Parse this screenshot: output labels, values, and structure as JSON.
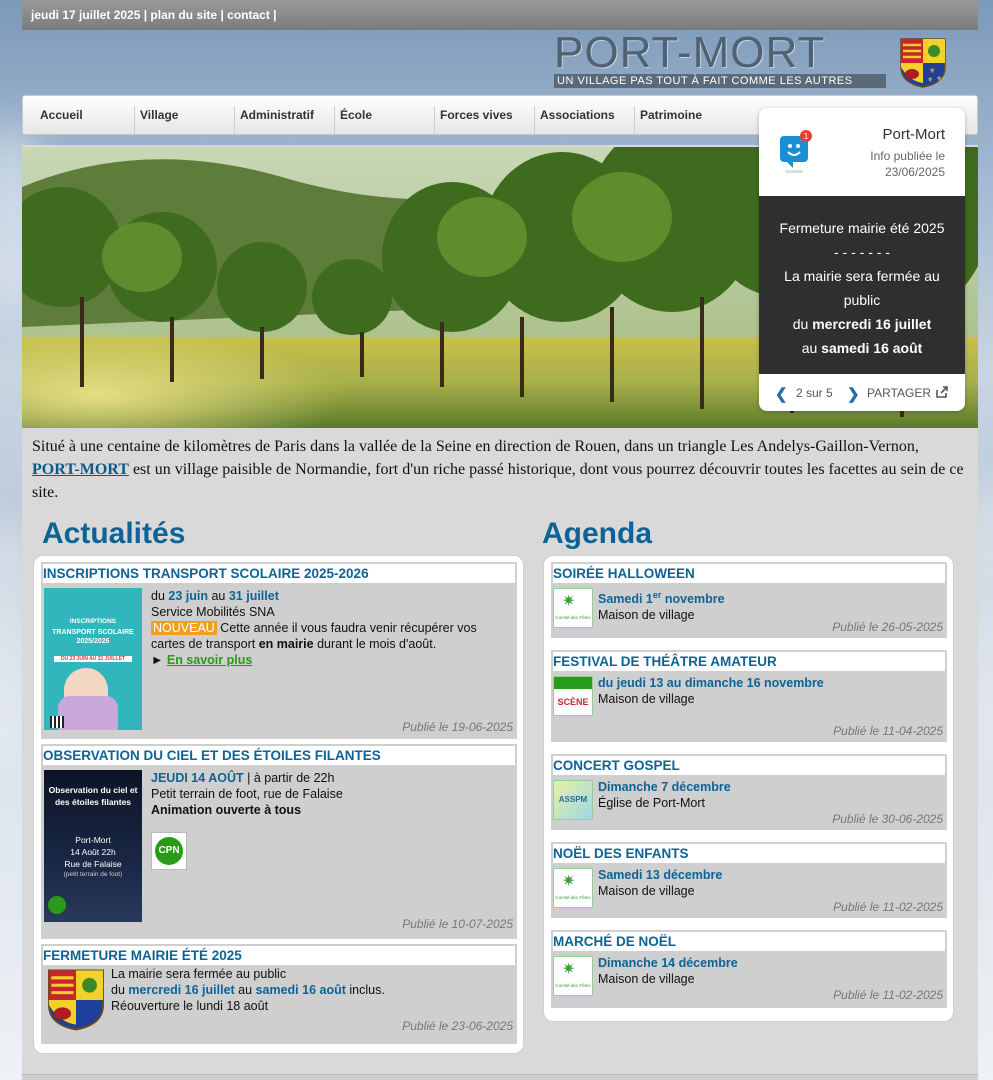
{
  "topbar": {
    "date": "jeudi 17 juillet 2025",
    "sep1": " | ",
    "sitemap": "plan du site",
    "sep2": " | ",
    "contact": "contact",
    "sep3": " |"
  },
  "logo": {
    "title": "PORT-MORT",
    "subtitle": "UN VILLAGE PAS TOUT À FAIT COMME LES AUTRES"
  },
  "nav": [
    "Accueil",
    "Village",
    "Administratif",
    "École",
    "Forces vives",
    "Associations",
    "Patrimoine"
  ],
  "widget": {
    "name": "Port-Mort",
    "published": "Info publiée le 23/06/2025",
    "badge": "1",
    "title": "Fermeture mairie été 2025",
    "separator": "- - - - - - -",
    "line1": "La mairie sera fermée au public",
    "line2a": "du ",
    "line2b": "mercredi 16 juillet",
    "line3a": "au ",
    "line3b": "samedi 16 août",
    "counter": "2 sur 5",
    "share": "PARTAGER"
  },
  "intro": {
    "before": "Situé à une centaine de kilomètres de Paris dans la vallée de la Seine en direction de Rouen, dans un triangle Les Andelys-Gaillon-Vernon, ",
    "link": "PORT-MORT",
    "after": " est un village paisible de Normandie, fort d'un riche passé historique, dont vous pourrez découvrir toutes les facettes au sein de ce site."
  },
  "news": {
    "heading": "Actualités",
    "items": [
      {
        "title": "INSCRIPTIONS TRANSPORT SCOLAIRE 2025-2026",
        "date_pre": "du ",
        "date_a": "23 juin",
        "date_mid": " au ",
        "date_b": "31 juillet",
        "line2": "Service Mobilités SNA",
        "nouveau": "NOUVEAU",
        "line3a": " Cette année il vous faudra venir récupérer vos cartes de transport ",
        "line3b": "en mairie",
        "line3c": " durant le mois d'août.",
        "more_arrow": "► ",
        "more": "En savoir plus",
        "thumb_label1": "INSCRIPTIONS",
        "thumb_label2": "TRANSPORT SCOLAIRE 2025/2026",
        "thumb_label3": "DU 23 JUIN AU 31 JUILLET",
        "published": "Publié le 19-06-2025"
      },
      {
        "title": "OBSERVATION DU CIEL ET DES ÉTOILES FILANTES",
        "date": "JEUDI 14 AOÛT",
        "date_after": " | à partir de 22h",
        "line2": "Petit terrain de foot, rue de Falaise",
        "line3": "Animation ouverte à tous",
        "thumb_title": "Observation du ciel et des étoiles filantes",
        "thumb_place": "Port-Mort",
        "thumb_when": "14 Août 22h",
        "thumb_street": "Rue de Falaise",
        "thumb_note": "(petit terrain de foot)",
        "logo_text": "CPN",
        "published": "Publié le 10-07-2025"
      },
      {
        "title": "FERMETURE MAIRIE ÉTÉ 2025",
        "line1": "La mairie sera fermée au public",
        "line2a": "du ",
        "line2b": "mercredi 16 juillet",
        "line2c": " au ",
        "line2d": "samedi 16 août",
        "line2e": " inclus.",
        "line3": "Réouverture le lundi 18 août",
        "published": "Publié le 23-06-2025"
      }
    ]
  },
  "agenda": {
    "heading": "Agenda",
    "items": [
      {
        "title": "SOIRÉE HALLOWEEN",
        "date": "Samedi 1",
        "date_sup": "er",
        "date_after": " novembre",
        "place": "Maison de village",
        "logo": "Comité des Fêtes",
        "published": "Publié le 26-05-2025"
      },
      {
        "title": "FESTIVAL DE THÉÂTRE AMATEUR",
        "date": "du jeudi 13 au dimanche 16 novembre",
        "place": "Maison de village",
        "logo": "SCÈNE",
        "published": "Publié le 11-04-2025"
      },
      {
        "title": "CONCERT GOSPEL",
        "date": "Dimanche 7 décembre",
        "place": "Église de Port-Mort",
        "logo": "ASSPM",
        "published": "Publié le 30-06-2025"
      },
      {
        "title": "NOËL DES ENFANTS",
        "date": "Samedi 13 décembre",
        "place": "Maison de village",
        "logo": "Comité des Fêtes",
        "published": "Publié le 11-02-2025"
      },
      {
        "title": "MARCHÉ DE NOËL",
        "date": "Dimanche 14 décembre",
        "place": "Maison de village",
        "logo": "Comité des Fêtes",
        "published": "Publié le 11-02-2025"
      }
    ]
  },
  "colors": {
    "accent": "#0d6396",
    "green": "#2a9a1a",
    "badge": "#f0a020"
  }
}
